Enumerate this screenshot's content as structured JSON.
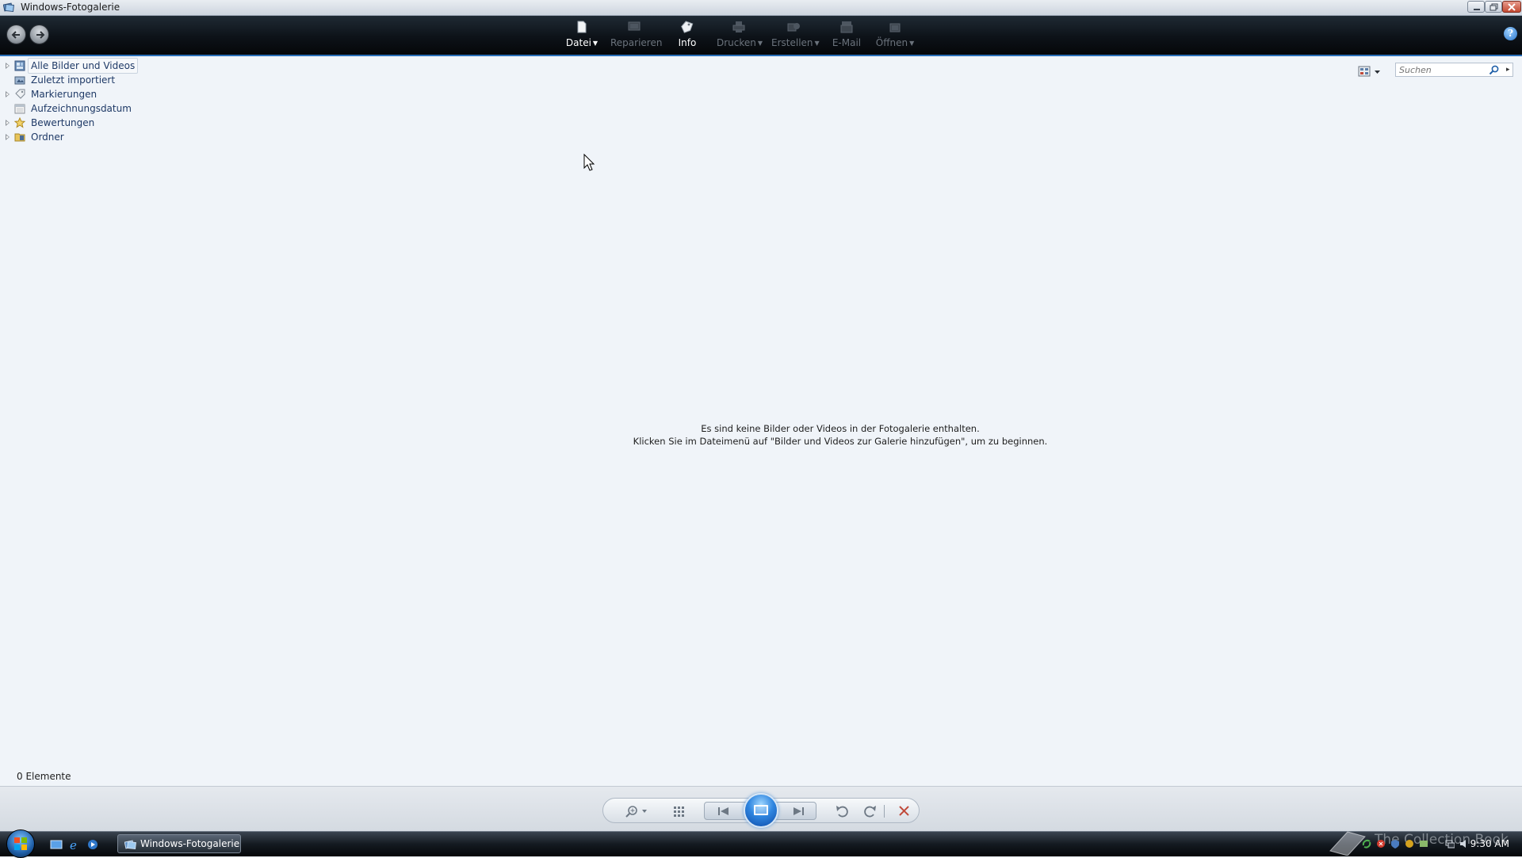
{
  "window": {
    "title": "Windows-Fotogalerie"
  },
  "toolbar": {
    "items": [
      {
        "label": "Datei",
        "icon": "file-icon",
        "enabled": true,
        "dropdown": true
      },
      {
        "label": "Reparieren",
        "icon": "repair-icon",
        "enabled": false,
        "dropdown": false
      },
      {
        "label": "Info",
        "icon": "tag-icon",
        "enabled": true,
        "dropdown": false
      },
      {
        "label": "Drucken",
        "icon": "printer-icon",
        "enabled": false,
        "dropdown": true
      },
      {
        "label": "Erstellen",
        "icon": "create-icon",
        "enabled": false,
        "dropdown": true
      },
      {
        "label": "E-Mail",
        "icon": "email-icon",
        "enabled": false,
        "dropdown": false
      },
      {
        "label": "Öffnen",
        "icon": "open-icon",
        "enabled": false,
        "dropdown": true
      }
    ],
    "help_label": "?"
  },
  "navigation": {
    "items": [
      {
        "label": "Alle Bilder und Videos",
        "icon": "photo-gallery-icon",
        "expandable": true,
        "selected": true
      },
      {
        "label": "Zuletzt importiert",
        "icon": "recent-import-icon",
        "expandable": false,
        "selected": false
      },
      {
        "label": "Markierungen",
        "icon": "tag-icon",
        "expandable": true,
        "selected": false
      },
      {
        "label": "Aufzeichnungsdatum",
        "icon": "calendar-icon",
        "expandable": true,
        "selected": false
      },
      {
        "label": "Bewertungen",
        "icon": "star-icon",
        "expandable": true,
        "selected": false
      },
      {
        "label": "Ordner",
        "icon": "folder-icon",
        "expandable": true,
        "selected": false
      }
    ]
  },
  "search": {
    "placeholder": "Suchen",
    "value": ""
  },
  "main": {
    "empty_line1": "Es sind keine Bilder oder Videos in der Fotogalerie enthalten.",
    "empty_line2": "Klicken Sie im Dateimenü auf \"Bilder und Videos zur Galerie hinzufügen\", um zu beginnen."
  },
  "status": {
    "count": "0 Elemente"
  },
  "taskbar": {
    "task_label": "Windows-Fotogalerie",
    "clock": "9:30 AM",
    "watermark": "The Collection Book"
  },
  "colors": {
    "accent": "#2a6fb8",
    "background": "#f0f4f9",
    "tree_text": "#1e3966",
    "toolbar_bg": "#0d1218"
  }
}
